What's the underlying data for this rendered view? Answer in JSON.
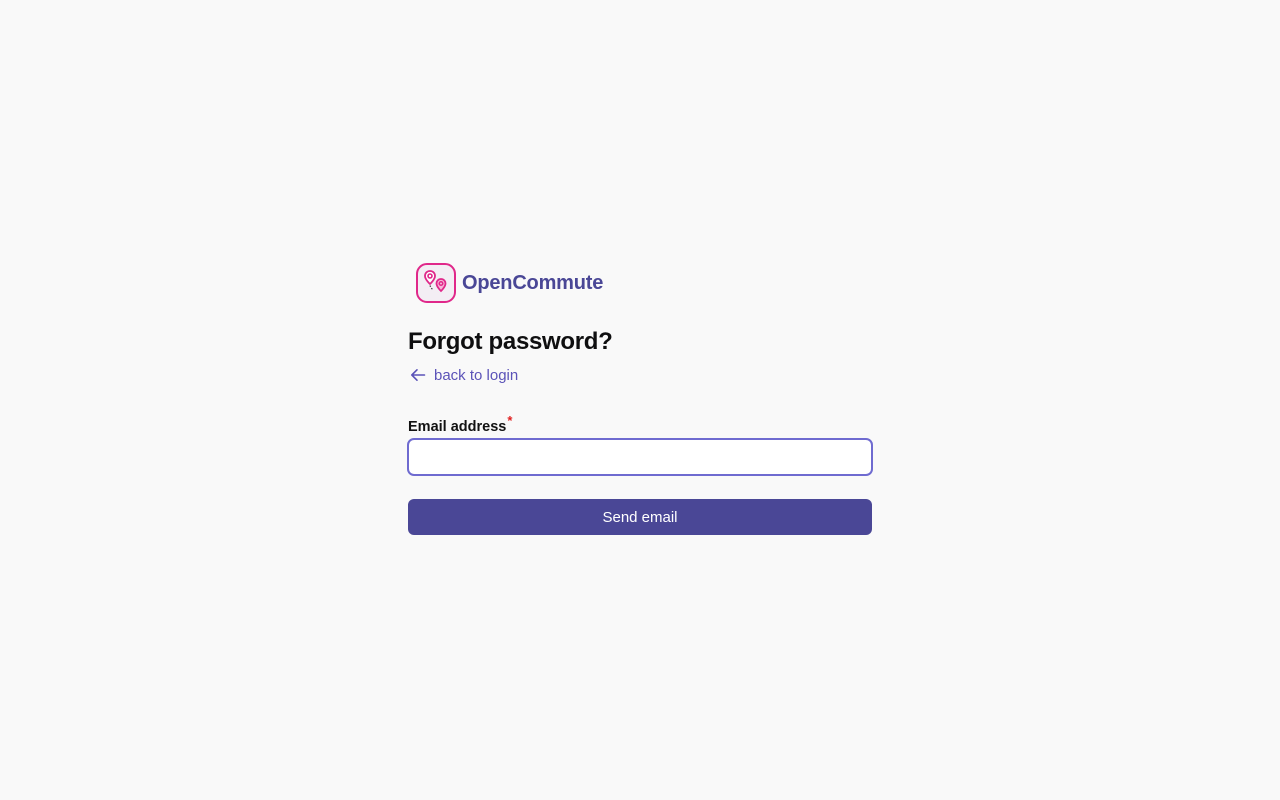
{
  "brand": {
    "name": "OpenCommute",
    "logo_icon": "map-pins-route-icon",
    "logo_color": "#e0288a",
    "brand_color": "#4a4796"
  },
  "form": {
    "title": "Forgot password?",
    "back_link": {
      "label": "back to login",
      "icon": "arrow-left-icon",
      "color": "#5b53b8"
    },
    "email": {
      "label": "Email address",
      "required_marker": "*",
      "value": "",
      "placeholder": ""
    },
    "submit_label": "Send email",
    "accent_color": "#4a4796",
    "focus_color": "#6f6bd0"
  }
}
